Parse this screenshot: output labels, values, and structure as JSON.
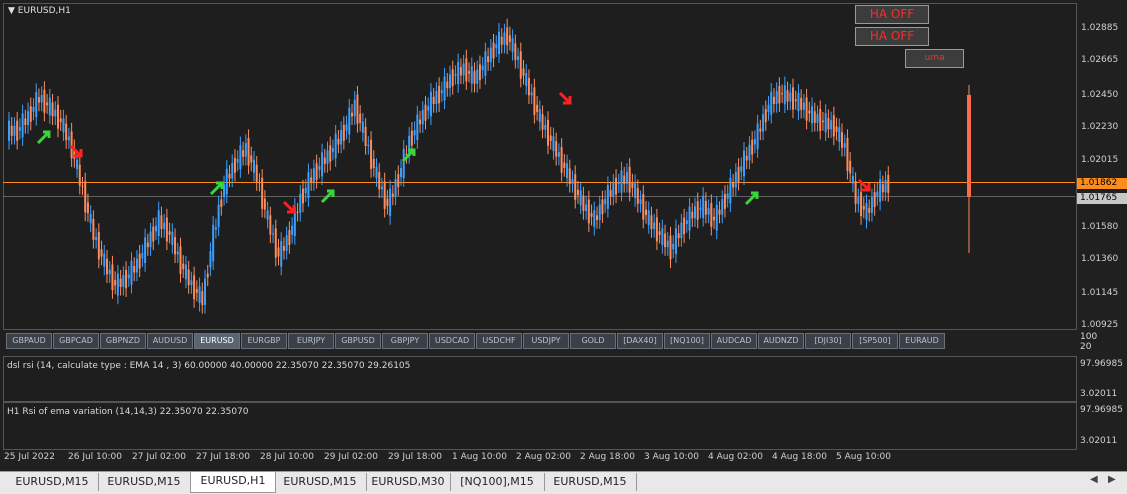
{
  "symbol_title": "EURUSD,H1",
  "buttons": {
    "ha_off_1": "HA OFF",
    "ha_off_2": "HA OFF",
    "uma": "uma"
  },
  "price_scale": [
    "1.02885",
    "1.02665",
    "1.02450",
    "1.02230",
    "1.02015",
    "1.01580",
    "1.01360",
    "1.01145",
    "1.00925"
  ],
  "current_price": "1.01862",
  "bid_price": "1.01765",
  "colors": {
    "bull": "#3aa0ff",
    "bear": "#ff8c5a",
    "hline": "#ff8c1a",
    "up_arrow": "#39d63a",
    "down_arrow": "#ff2020",
    "rsi_up": "#30ff80",
    "rsi_down": "#ff2050",
    "ema_up": "#30b8ff",
    "ema_down": "#ff2030"
  },
  "symbol_tabs": [
    "GBPAUD",
    "GBPCAD",
    "GBPNZD",
    "AUDUSD",
    "EURUSD",
    "EURGBP",
    "EURJPY",
    "GBPUSD",
    "GBPJPY",
    "USDCAD",
    "USDCHF",
    "USDJPY",
    "GOLD",
    "[DAX40]",
    "[NQ100]",
    "AUDCAD",
    "AUDNZD",
    "[DJI30]",
    "[SP500]",
    "EURAUD"
  ],
  "active_symbol_tab": "EURUSD",
  "tab_scale": [
    "100",
    "20"
  ],
  "indicator1": {
    "label": "dsl rsi (14, calculate type : EMA  14 , 3) 60.00000 40.00000 22.35070 22.35070 29.26105",
    "scale_top": "97.96985",
    "scale_bottom": "3.02011"
  },
  "indicator2": {
    "label": "H1 Rsi of ema variation (14,14,3) 22.35070 22.35070",
    "scale_top": "97.96985",
    "scale_bottom": "3.02011"
  },
  "x_labels": [
    "25 Jul 2022",
    "26 Jul 10:00",
    "27 Jul 02:00",
    "27 Jul 18:00",
    "28 Jul 10:00",
    "29 Jul 02:00",
    "29 Jul 18:00",
    "1 Aug 10:00",
    "2 Aug 02:00",
    "2 Aug 18:00",
    "3 Aug 10:00",
    "4 Aug 02:00",
    "4 Aug 18:00",
    "5 Aug 10:00"
  ],
  "bottom_tabs": [
    "EURUSD,M15",
    "EURUSD,M15",
    "EURUSD,H1",
    "EURUSD,M15",
    "EURUSD,M30",
    "[NQ100],M15",
    "EURUSD,M15"
  ],
  "active_bottom_tab": "EURUSD,H1",
  "chart_data": {
    "type": "candlestick",
    "ylim": [
      1.00925,
      1.03
    ],
    "close_series": [
      1.0222,
      1.0232,
      1.0245,
      1.0238,
      1.0228,
      1.021,
      1.018,
      1.015,
      1.013,
      1.0115,
      1.012,
      1.013,
      1.0145,
      1.016,
      1.015,
      1.013,
      1.0115,
      1.0105,
      1.015,
      1.0185,
      1.02,
      1.021,
      1.019,
      1.016,
      1.0135,
      1.015,
      1.0175,
      1.019,
      1.02,
      1.021,
      1.0222,
      1.024,
      1.0215,
      1.019,
      1.017,
      1.019,
      1.0215,
      1.023,
      1.0242,
      1.025,
      1.026,
      1.0265,
      1.0258,
      1.027,
      1.0282,
      1.0288,
      1.027,
      1.025,
      1.023,
      1.0215,
      1.02,
      1.0185,
      1.017,
      1.016,
      1.0175,
      1.0185,
      1.019,
      1.0175,
      1.016,
      1.015,
      1.014,
      1.0155,
      1.0165,
      1.017,
      1.016,
      1.0175,
      1.019,
      1.0205,
      1.022,
      1.024,
      1.0248,
      1.0245,
      1.024,
      1.0232,
      1.0228,
      1.0225,
      1.021,
      1.0175,
      1.0165,
      1.018,
      1.0186
    ],
    "current_price": 1.01862,
    "bid_price": 1.01765
  }
}
